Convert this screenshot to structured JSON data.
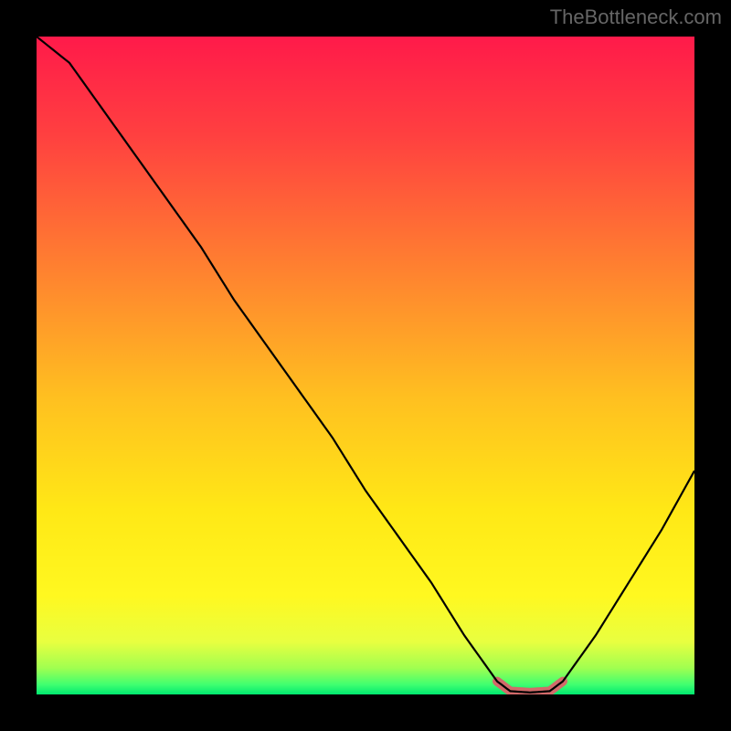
{
  "attribution": "TheBottleneck.com",
  "chart_data": {
    "type": "line",
    "title": "",
    "xlabel": "",
    "ylabel": "",
    "xlim": [
      0,
      100
    ],
    "ylim": [
      0,
      100
    ],
    "x": [
      0,
      5,
      10,
      15,
      20,
      25,
      30,
      35,
      40,
      45,
      50,
      55,
      60,
      65,
      70,
      72,
      75,
      78,
      80,
      85,
      90,
      95,
      100
    ],
    "values": [
      100,
      96,
      89,
      82,
      75,
      68,
      60,
      53,
      46,
      39,
      31,
      24,
      17,
      9,
      2,
      0.5,
      0.3,
      0.5,
      2,
      9,
      17,
      25,
      34
    ],
    "highlight": {
      "x_start": 70,
      "x_end": 80,
      "color": "#d26a6a"
    },
    "gradient_stops": [
      {
        "offset": 0.0,
        "color": "#ff1a4a"
      },
      {
        "offset": 0.15,
        "color": "#ff4040"
      },
      {
        "offset": 0.35,
        "color": "#ff8030"
      },
      {
        "offset": 0.55,
        "color": "#ffc020"
      },
      {
        "offset": 0.72,
        "color": "#ffe816"
      },
      {
        "offset": 0.85,
        "color": "#fff820"
      },
      {
        "offset": 0.92,
        "color": "#e8ff40"
      },
      {
        "offset": 0.96,
        "color": "#a0ff50"
      },
      {
        "offset": 0.985,
        "color": "#40ff70"
      },
      {
        "offset": 1.0,
        "color": "#00e870"
      }
    ]
  },
  "plot": {
    "viewbox_w": 720,
    "viewbox_h": 720
  }
}
